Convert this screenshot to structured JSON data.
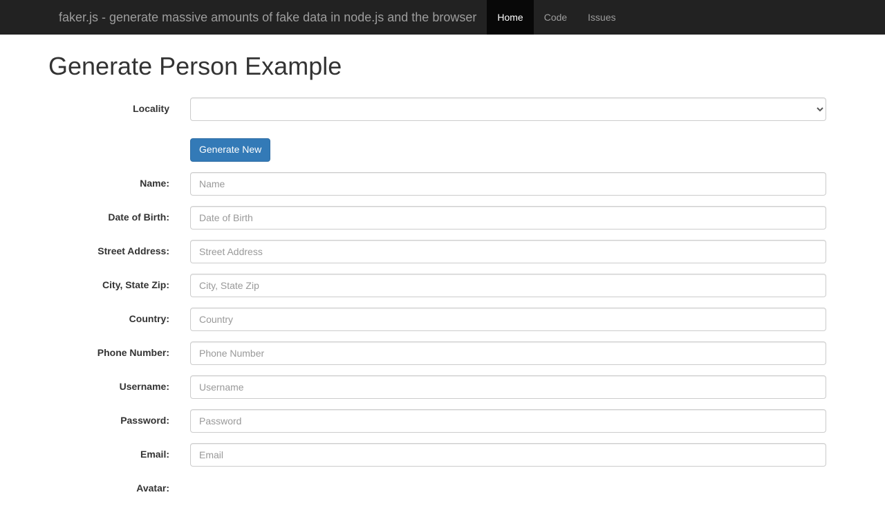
{
  "navbar": {
    "brand": "faker.js - generate massive amounts of fake data in node.js and the browser",
    "items": [
      {
        "label": "Home",
        "active": true
      },
      {
        "label": "Code",
        "active": false
      },
      {
        "label": "Issues",
        "active": false
      }
    ]
  },
  "page": {
    "title": "Generate Person Example"
  },
  "generate_button_label": "Generate New",
  "fields": {
    "locality": {
      "label": "Locality",
      "value": "",
      "placeholder": ""
    },
    "name": {
      "label": "Name:",
      "value": "",
      "placeholder": "Name"
    },
    "dob": {
      "label": "Date of Birth:",
      "value": "",
      "placeholder": "Date of Birth"
    },
    "street": {
      "label": "Street Address:",
      "value": "",
      "placeholder": "Street Address"
    },
    "city_state_zip": {
      "label": "City, State Zip:",
      "value": "",
      "placeholder": "City, State Zip"
    },
    "country": {
      "label": "Country:",
      "value": "",
      "placeholder": "Country"
    },
    "phone": {
      "label": "Phone Number:",
      "value": "",
      "placeholder": "Phone Number"
    },
    "username": {
      "label": "Username:",
      "value": "",
      "placeholder": "Username"
    },
    "password": {
      "label": "Password:",
      "value": "",
      "placeholder": "Password"
    },
    "email": {
      "label": "Email:",
      "value": "",
      "placeholder": "Email"
    },
    "avatar": {
      "label": "Avatar:",
      "value": "",
      "placeholder": ""
    }
  }
}
